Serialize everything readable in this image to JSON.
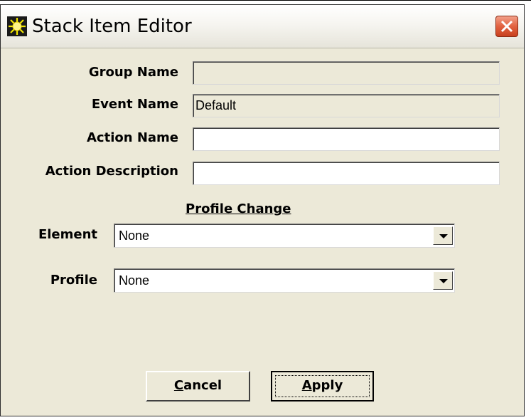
{
  "window": {
    "title": "Stack Item Editor",
    "app_icon": "sun-icon",
    "close_icon": "close-icon"
  },
  "form": {
    "group_name": {
      "label": "Group Name",
      "value": ""
    },
    "event_name": {
      "label": "Event Name",
      "value": "Default"
    },
    "action_name": {
      "label": "Action Name",
      "value": ""
    },
    "action_description": {
      "label": "Action Description",
      "value": ""
    }
  },
  "profile_change": {
    "title": "Profile Change",
    "element": {
      "label": "Element",
      "value": "None"
    },
    "profile": {
      "label": "Profile",
      "value": "None"
    }
  },
  "buttons": {
    "cancel": {
      "accel": "C",
      "rest": "ancel"
    },
    "apply": {
      "accel": "A",
      "rest": "pply"
    }
  },
  "colors": {
    "close_button": "#e26240",
    "dialog_bg": "#ece9d8"
  }
}
